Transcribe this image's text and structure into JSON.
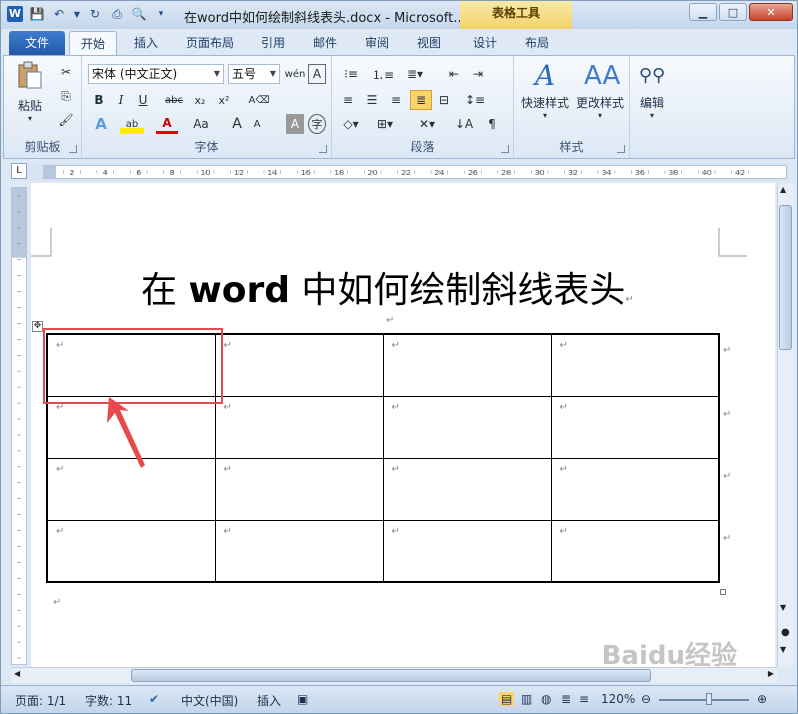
{
  "window": {
    "title": "在word中如何绘制斜线表头.docx - Microsoft...",
    "context_tab": "表格工具",
    "controls": {
      "minimize": "▁",
      "maximize": "□",
      "close": "✕"
    }
  },
  "tabs": [
    {
      "label": "文件"
    },
    {
      "label": "开始"
    },
    {
      "label": "插入"
    },
    {
      "label": "页面布局"
    },
    {
      "label": "引用"
    },
    {
      "label": "邮件"
    },
    {
      "label": "审阅"
    },
    {
      "label": "视图"
    },
    {
      "label": "设计"
    },
    {
      "label": "布局"
    }
  ],
  "ribbon": {
    "clipboard": {
      "label": "剪贴板",
      "paste": "粘贴"
    },
    "font": {
      "label": "字体",
      "name": "宋体 (中文正文)",
      "size": "五号",
      "bold": "B",
      "italic": "I",
      "underline": "U",
      "strike": "abc",
      "sub": "x₂",
      "sup": "x²",
      "grow": "A",
      "shrink": "A",
      "case": "Aa"
    },
    "paragraph": {
      "label": "段落"
    },
    "styles": {
      "label": "样式",
      "quick": "快速样式",
      "change": "更改样式"
    },
    "editing": {
      "label": "编辑"
    }
  },
  "ruler": {
    "ticks": [
      "2",
      "4",
      "6",
      "8",
      "10",
      "12",
      "14",
      "16",
      "18",
      "20",
      "22",
      "24",
      "26",
      "28",
      "30",
      "32",
      "34",
      "36",
      "38",
      "40",
      "42"
    ]
  },
  "document": {
    "heading_prefix": "在 ",
    "heading_bold": "word",
    "heading_suffix": " 中如何绘制斜线表头",
    "para_mark": "↵"
  },
  "status": {
    "page": "页面: 1/1",
    "words": "字数: 11",
    "lang": "中文(中国)",
    "insert": "插入",
    "zoom": "120%"
  },
  "watermark": "Baidu经验",
  "colors": {
    "highlight": "#e64b4b",
    "arrow": "#e64b4b",
    "file_tab": "#2a62b0"
  }
}
